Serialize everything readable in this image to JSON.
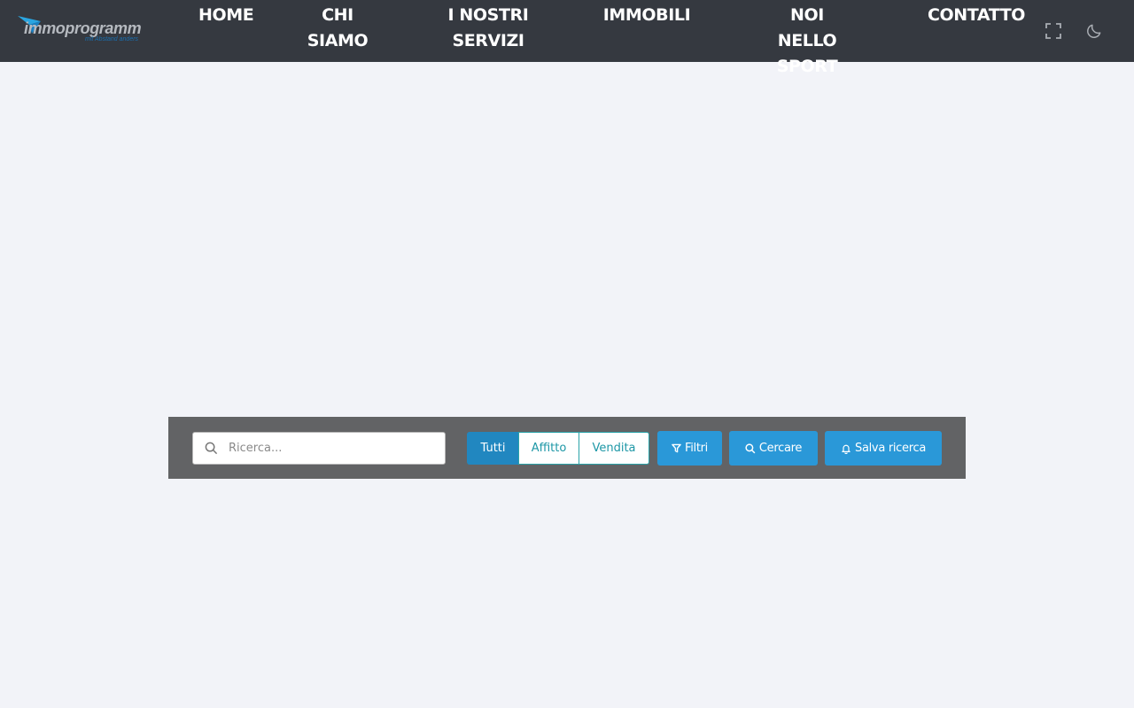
{
  "header": {
    "logo": {
      "name": "immoprogramm",
      "tagline": "mit Abstand anders"
    },
    "nav": [
      {
        "label_line1": "HOME",
        "label_line2": ""
      },
      {
        "label_line1": "CHI",
        "label_line2": "SIAMO"
      },
      {
        "label_line1": "I NOSTRI",
        "label_line2": "SERVIZI"
      },
      {
        "label_line1": "IMMOBILI",
        "label_line2": ""
      },
      {
        "label_line1": "NOI NELLO",
        "label_line2": "SPORT"
      },
      {
        "label_line1": "CONTATTO",
        "label_line2": ""
      }
    ],
    "icons": {
      "fullscreen": "fullscreen-icon",
      "dark_mode": "moon-icon"
    }
  },
  "search": {
    "placeholder": "Ricerca...",
    "value": "",
    "segments": [
      "Tutti",
      "Affitto",
      "Vendita"
    ],
    "active_segment": "Tutti",
    "buttons": {
      "filters": "Filtri",
      "search": "Cercare",
      "save": "Salva ricerca"
    }
  },
  "colors": {
    "topbar": "#353940",
    "background": "#f2f3f8",
    "searchbar": "#626365",
    "primary": "#2a98d8",
    "segment_active": "#2187c0",
    "segment_outline": "#1d97a6"
  }
}
